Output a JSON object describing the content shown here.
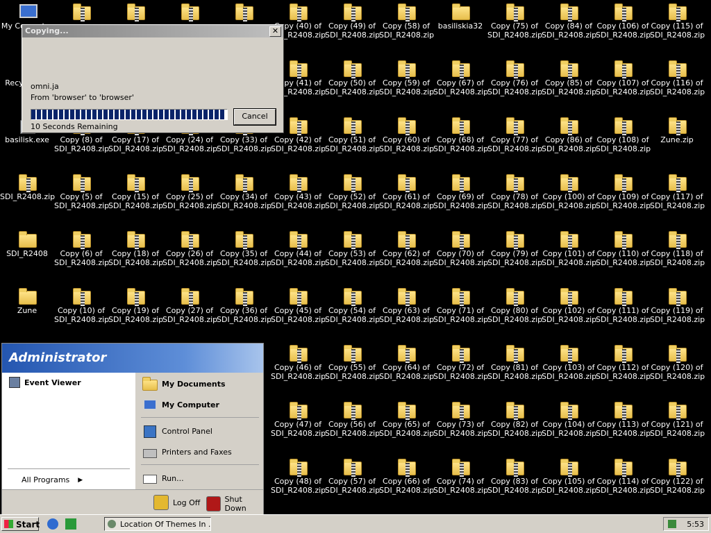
{
  "desktop": {
    "icons": [
      {
        "label": "My Computer",
        "kind": "pc",
        "col": 0,
        "row": 0
      },
      {
        "label": "Recycle Bin",
        "kind": "bin",
        "col": 0,
        "row": 1
      },
      {
        "label": "basilisk.exe",
        "kind": "exe",
        "col": 0,
        "row": 2
      },
      {
        "label": "SDI_R2408.zip",
        "kind": "zip",
        "col": 0,
        "row": 3
      },
      {
        "label": "SDI_R2408",
        "kind": "folder",
        "col": 0,
        "row": 4
      },
      {
        "label": "Zune",
        "kind": "folder",
        "col": 0,
        "row": 5
      },
      {
        "label": "",
        "kind": "zip",
        "col": 1,
        "row": 0
      },
      {
        "label": "",
        "kind": "zip",
        "col": 1,
        "row": 1
      },
      {
        "label": "Copy (8) of\nSDI_R2408.zip",
        "kind": "zip",
        "col": 1,
        "row": 2
      },
      {
        "label": "Copy (5) of\nSDI_R2408.zip",
        "kind": "zip",
        "col": 1,
        "row": 3
      },
      {
        "label": "Copy (6) of\nSDI_R2408.zip",
        "kind": "zip",
        "col": 1,
        "row": 4
      },
      {
        "label": "Copy (10) of\nSDI_R2408.zip",
        "kind": "zip",
        "col": 1,
        "row": 5
      },
      {
        "label": "",
        "kind": "zip",
        "col": 2,
        "row": 0
      },
      {
        "label": "",
        "kind": "zip",
        "col": 2,
        "row": 1
      },
      {
        "label": "Copy (17) of\nSDI_R2408.zip",
        "kind": "zip",
        "col": 2,
        "row": 2
      },
      {
        "label": "Copy (15) of\nSDI_R2408.zip",
        "kind": "zip",
        "col": 2,
        "row": 3
      },
      {
        "label": "Copy (18) of\nSDI_R2408.zip",
        "kind": "zip",
        "col": 2,
        "row": 4
      },
      {
        "label": "Copy (19) of\nSDI_R2408.zip",
        "kind": "zip",
        "col": 2,
        "row": 5
      },
      {
        "label": "",
        "kind": "zip",
        "col": 3,
        "row": 0
      },
      {
        "label": "",
        "kind": "zip",
        "col": 3,
        "row": 1
      },
      {
        "label": "Copy (24) of\nSDI_R2408.zip",
        "kind": "zip",
        "col": 3,
        "row": 2
      },
      {
        "label": "Copy (25) of\nSDI_R2408.zip",
        "kind": "zip",
        "col": 3,
        "row": 3
      },
      {
        "label": "Copy (26) of\nSDI_R2408.zip",
        "kind": "zip",
        "col": 3,
        "row": 4
      },
      {
        "label": "Copy (27) of\nSDI_R2408.zip",
        "kind": "zip",
        "col": 3,
        "row": 5
      },
      {
        "label": "",
        "kind": "zip",
        "col": 4,
        "row": 0
      },
      {
        "label": "",
        "kind": "zip",
        "col": 4,
        "row": 1
      },
      {
        "label": "Copy (33) of\nSDI_R2408.zip",
        "kind": "zip",
        "col": 4,
        "row": 2
      },
      {
        "label": "Copy (34) of\nSDI_R2408.zip",
        "kind": "zip",
        "col": 4,
        "row": 3
      },
      {
        "label": "Copy (35) of\nSDI_R2408.zip",
        "kind": "zip",
        "col": 4,
        "row": 4
      },
      {
        "label": "Copy (36) of\nSDI_R2408.zip",
        "kind": "zip",
        "col": 4,
        "row": 5
      },
      {
        "label": "Copy (40) of\nSDI_R2408.zip",
        "kind": "zip",
        "col": 5,
        "row": 0
      },
      {
        "label": "Copy (41) of\nSDI_R2408.zip",
        "kind": "zip",
        "col": 5,
        "row": 1
      },
      {
        "label": "Copy (42) of\nSDI_R2408.zip",
        "kind": "zip",
        "col": 5,
        "row": 2
      },
      {
        "label": "Copy (43) of\nSDI_R2408.zip",
        "kind": "zip",
        "col": 5,
        "row": 3
      },
      {
        "label": "Copy (44) of\nSDI_R2408.zip",
        "kind": "zip",
        "col": 5,
        "row": 4
      },
      {
        "label": "Copy (45) of\nSDI_R2408.zip",
        "kind": "zip",
        "col": 5,
        "row": 5
      },
      {
        "label": "Copy (46) of\nSDI_R2408.zip",
        "kind": "zip",
        "col": 5,
        "row": 6
      },
      {
        "label": "Copy (47) of\nSDI_R2408.zip",
        "kind": "zip",
        "col": 5,
        "row": 7
      },
      {
        "label": "Copy (48) of\nSDI_R2408.zip",
        "kind": "zip",
        "col": 5,
        "row": 8
      },
      {
        "label": "Copy (49) of\nSDI_R2408.zip",
        "kind": "zip",
        "col": 6,
        "row": 0
      },
      {
        "label": "Copy (50) of\nSDI_R2408.zip",
        "kind": "zip",
        "col": 6,
        "row": 1
      },
      {
        "label": "Copy (51) of\nSDI_R2408.zip",
        "kind": "zip",
        "col": 6,
        "row": 2
      },
      {
        "label": "Copy (52) of\nSDI_R2408.zip",
        "kind": "zip",
        "col": 6,
        "row": 3
      },
      {
        "label": "Copy (53) of\nSDI_R2408.zip",
        "kind": "zip",
        "col": 6,
        "row": 4
      },
      {
        "label": "Copy (54) of\nSDI_R2408.zip",
        "kind": "zip",
        "col": 6,
        "row": 5
      },
      {
        "label": "Copy (55) of\nSDI_R2408.zip",
        "kind": "zip",
        "col": 6,
        "row": 6
      },
      {
        "label": "Copy (56) of\nSDI_R2408.zip",
        "kind": "zip",
        "col": 6,
        "row": 7
      },
      {
        "label": "Copy (57) of\nSDI_R2408.zip",
        "kind": "zip",
        "col": 6,
        "row": 8
      },
      {
        "label": "Copy (58) of\nSDI_R2408.zip",
        "kind": "zip",
        "col": 7,
        "row": 0
      },
      {
        "label": "Copy (59) of\nSDI_R2408.zip",
        "kind": "zip",
        "col": 7,
        "row": 1
      },
      {
        "label": "Copy (60) of\nSDI_R2408.zip",
        "kind": "zip",
        "col": 7,
        "row": 2
      },
      {
        "label": "Copy (61) of\nSDI_R2408.zip",
        "kind": "zip",
        "col": 7,
        "row": 3
      },
      {
        "label": "Copy (62) of\nSDI_R2408.zip",
        "kind": "zip",
        "col": 7,
        "row": 4
      },
      {
        "label": "Copy (63) of\nSDI_R2408.zip",
        "kind": "zip",
        "col": 7,
        "row": 5
      },
      {
        "label": "Copy (64) of\nSDI_R2408.zip",
        "kind": "zip",
        "col": 7,
        "row": 6
      },
      {
        "label": "Copy (65) of\nSDI_R2408.zip",
        "kind": "zip",
        "col": 7,
        "row": 7
      },
      {
        "label": "Copy (66) of\nSDI_R2408.zip",
        "kind": "zip",
        "col": 7,
        "row": 8
      },
      {
        "label": "basiliskia32",
        "kind": "folder",
        "col": 8,
        "row": 0
      },
      {
        "label": "Copy (67) of\nSDI_R2408.zip",
        "kind": "zip",
        "col": 8,
        "row": 1
      },
      {
        "label": "Copy (68) of\nSDI_R2408.zip",
        "kind": "zip",
        "col": 8,
        "row": 2
      },
      {
        "label": "Copy (69) of\nSDI_R2408.zip",
        "kind": "zip",
        "col": 8,
        "row": 3
      },
      {
        "label": "Copy (70) of\nSDI_R2408.zip",
        "kind": "zip",
        "col": 8,
        "row": 4
      },
      {
        "label": "Copy (71) of\nSDI_R2408.zip",
        "kind": "zip",
        "col": 8,
        "row": 5
      },
      {
        "label": "Copy (72) of\nSDI_R2408.zip",
        "kind": "zip",
        "col": 8,
        "row": 6
      },
      {
        "label": "Copy (73) of\nSDI_R2408.zip",
        "kind": "zip",
        "col": 8,
        "row": 7
      },
      {
        "label": "Copy (74) of\nSDI_R2408.zip",
        "kind": "zip",
        "col": 8,
        "row": 8
      },
      {
        "label": "Copy (75) of\nSDI_R2408.zip",
        "kind": "zip",
        "col": 9,
        "row": 0
      },
      {
        "label": "Copy (76) of\nSDI_R2408.zip",
        "kind": "zip",
        "col": 9,
        "row": 1
      },
      {
        "label": "Copy (77) of\nSDI_R2408.zip",
        "kind": "zip",
        "col": 9,
        "row": 2
      },
      {
        "label": "Copy (78) of\nSDI_R2408.zip",
        "kind": "zip",
        "col": 9,
        "row": 3
      },
      {
        "label": "Copy (79) of\nSDI_R2408.zip",
        "kind": "zip",
        "col": 9,
        "row": 4
      },
      {
        "label": "Copy (80) of\nSDI_R2408.zip",
        "kind": "zip",
        "col": 9,
        "row": 5
      },
      {
        "label": "Copy (81) of\nSDI_R2408.zip",
        "kind": "zip",
        "col": 9,
        "row": 6
      },
      {
        "label": "Copy (82) of\nSDI_R2408.zip",
        "kind": "zip",
        "col": 9,
        "row": 7
      },
      {
        "label": "Copy (83) of\nSDI_R2408.zip",
        "kind": "zip",
        "col": 9,
        "row": 8
      },
      {
        "label": "Copy (84) of\nSDI_R2408.zip",
        "kind": "zip",
        "col": 10,
        "row": 0
      },
      {
        "label": "Copy (85) of\nSDI_R2408.zip",
        "kind": "zip",
        "col": 10,
        "row": 1
      },
      {
        "label": "Copy (86) of\nSDI_R2408.zip",
        "kind": "zip",
        "col": 10,
        "row": 2
      },
      {
        "label": "Copy (100) of\nSDI_R2408.zip",
        "kind": "zip",
        "col": 10,
        "row": 3
      },
      {
        "label": "Copy (101) of\nSDI_R2408.zip",
        "kind": "zip",
        "col": 10,
        "row": 4
      },
      {
        "label": "Copy (102) of\nSDI_R2408.zip",
        "kind": "zip",
        "col": 10,
        "row": 5
      },
      {
        "label": "Copy (103) of\nSDI_R2408.zip",
        "kind": "zip",
        "col": 10,
        "row": 6
      },
      {
        "label": "Copy (104) of\nSDI_R2408.zip",
        "kind": "zip",
        "col": 10,
        "row": 7
      },
      {
        "label": "Copy (105) of\nSDI_R2408.zip",
        "kind": "zip",
        "col": 10,
        "row": 8
      },
      {
        "label": "Copy (106) of\nSDI_R2408.zip",
        "kind": "zip",
        "col": 11,
        "row": 0
      },
      {
        "label": "Copy (107) of\nSDI_R2408.zip",
        "kind": "zip",
        "col": 11,
        "row": 1
      },
      {
        "label": "Copy (108) of\nSDI_R2408.zip",
        "kind": "zip",
        "col": 11,
        "row": 2
      },
      {
        "label": "Copy (109) of\nSDI_R2408.zip",
        "kind": "zip",
        "col": 11,
        "row": 3
      },
      {
        "label": "Copy (110) of\nSDI_R2408.zip",
        "kind": "zip",
        "col": 11,
        "row": 4
      },
      {
        "label": "Copy (111) of\nSDI_R2408.zip",
        "kind": "zip",
        "col": 11,
        "row": 5
      },
      {
        "label": "Copy (112) of\nSDI_R2408.zip",
        "kind": "zip",
        "col": 11,
        "row": 6
      },
      {
        "label": "Copy (113) of\nSDI_R2408.zip",
        "kind": "zip",
        "col": 11,
        "row": 7
      },
      {
        "label": "Copy (114) of\nSDI_R2408.zip",
        "kind": "zip",
        "col": 11,
        "row": 8
      },
      {
        "label": "Copy (115) of\nSDI_R2408.zip",
        "kind": "zip",
        "col": 12,
        "row": 0
      },
      {
        "label": "Copy (116) of\nSDI_R2408.zip",
        "kind": "zip",
        "col": 12,
        "row": 1
      },
      {
        "label": "Zune.zip",
        "kind": "zip",
        "col": 12,
        "row": 2
      },
      {
        "label": "Copy (117) of\nSDI_R2408.zip",
        "kind": "zip",
        "col": 12,
        "row": 3
      },
      {
        "label": "Copy (118) of\nSDI_R2408.zip",
        "kind": "zip",
        "col": 12,
        "row": 4
      },
      {
        "label": "Copy (119) of\nSDI_R2408.zip",
        "kind": "zip",
        "col": 12,
        "row": 5
      },
      {
        "label": "Copy (120) of\nSDI_R2408.zip",
        "kind": "zip",
        "col": 12,
        "row": 6
      },
      {
        "label": "Copy (121) of\nSDI_R2408.zip",
        "kind": "zip",
        "col": 12,
        "row": 7
      },
      {
        "label": "Copy (122) of\nSDI_R2408.zip",
        "kind": "zip",
        "col": 12,
        "row": 8
      }
    ]
  },
  "copy_dialog": {
    "title": "Copying...",
    "close_glyph": "✕",
    "file_name": "omni.ja",
    "from_to": "From 'browser' to 'browser'",
    "remaining": "10 Seconds Remaining",
    "cancel_label": "Cancel",
    "progress_fraction": 0.99
  },
  "start_menu": {
    "user": "Administrator",
    "left_items": [
      {
        "label": "Event Viewer"
      }
    ],
    "all_programs": "All Programs",
    "right_items": [
      {
        "label": "My Documents",
        "bold": true
      },
      {
        "label": "My Computer",
        "bold": true
      },
      {
        "label": "Control Panel",
        "bold": false
      },
      {
        "label": "Printers and Faxes",
        "bold": false
      },
      {
        "label": "Run...",
        "bold": false
      }
    ],
    "log_off": "Log Off",
    "shut_down": "Shut Down"
  },
  "taskbar": {
    "start_label": "Start",
    "task_item": "Location Of Themes In ...",
    "clock": "5:53"
  }
}
